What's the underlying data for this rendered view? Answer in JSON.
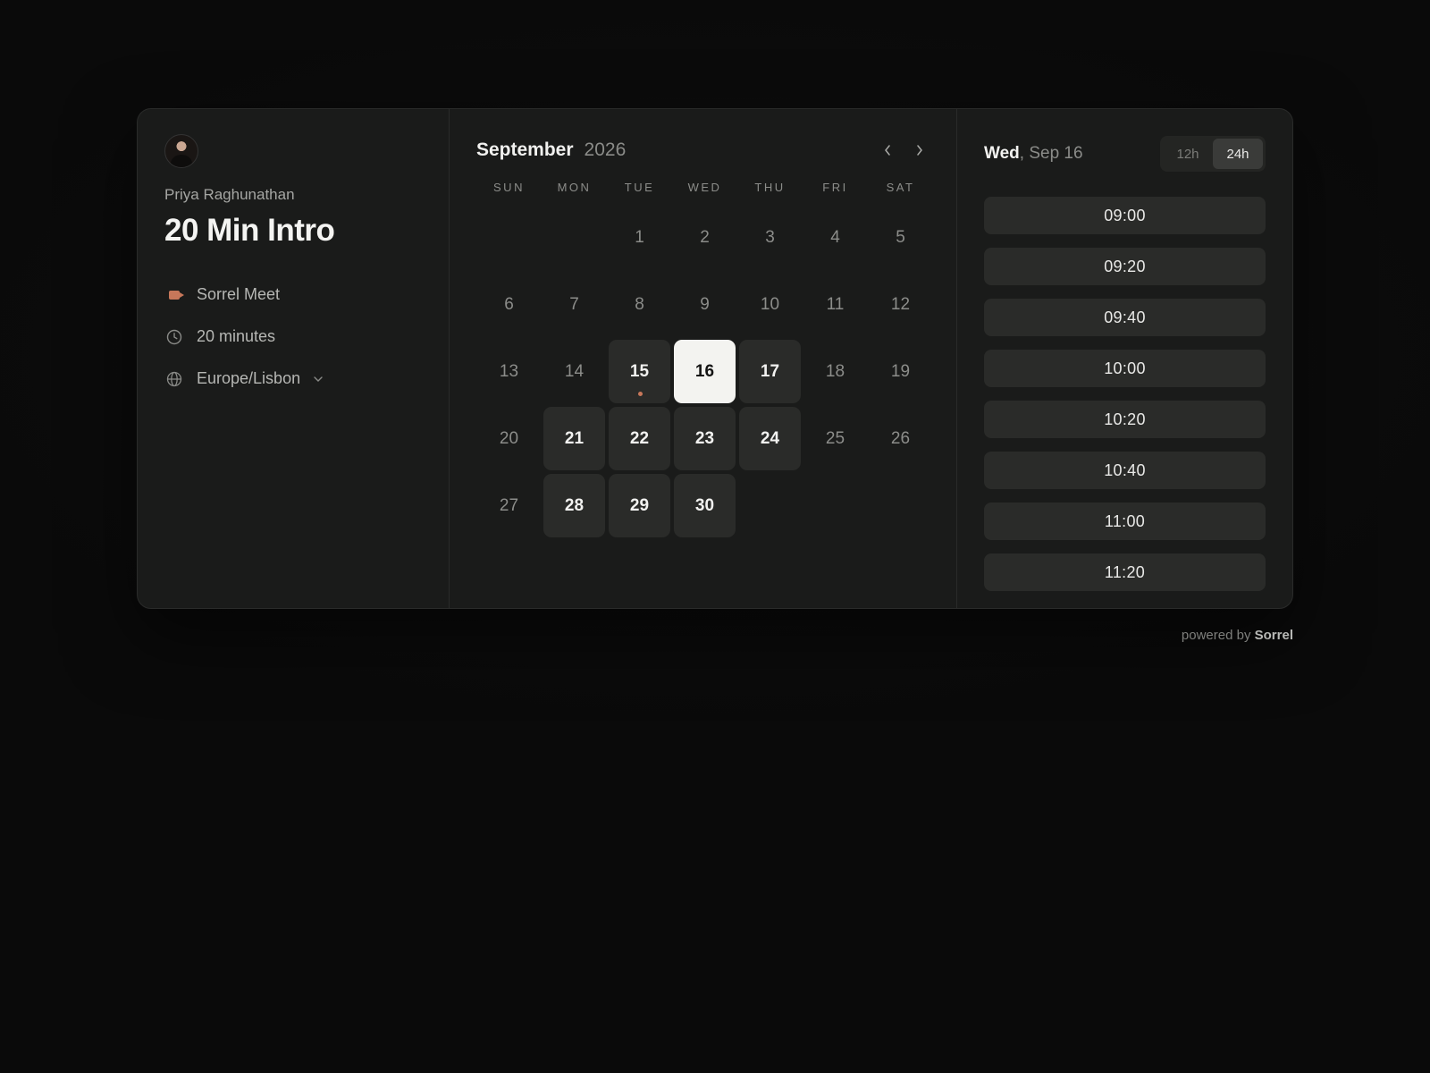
{
  "event": {
    "host": "Priya Raghunathan",
    "title": "20 Min Intro",
    "location": "Sorrel Meet",
    "duration": "20 minutes",
    "timezone": "Europe/Lisbon"
  },
  "calendar": {
    "month": "September",
    "year": "2026",
    "weekdays": [
      "SUN",
      "MON",
      "TUE",
      "WED",
      "THU",
      "FRI",
      "SAT"
    ],
    "leading_blanks": 2,
    "days": [
      {
        "n": "1",
        "state": "off"
      },
      {
        "n": "2",
        "state": "off"
      },
      {
        "n": "3",
        "state": "off"
      },
      {
        "n": "4",
        "state": "off"
      },
      {
        "n": "5",
        "state": "off"
      },
      {
        "n": "6",
        "state": "off"
      },
      {
        "n": "7",
        "state": "off"
      },
      {
        "n": "8",
        "state": "off"
      },
      {
        "n": "9",
        "state": "off"
      },
      {
        "n": "10",
        "state": "off"
      },
      {
        "n": "11",
        "state": "off"
      },
      {
        "n": "12",
        "state": "off"
      },
      {
        "n": "13",
        "state": "off"
      },
      {
        "n": "14",
        "state": "off"
      },
      {
        "n": "15",
        "state": "avail",
        "today": true
      },
      {
        "n": "16",
        "state": "sel"
      },
      {
        "n": "17",
        "state": "avail"
      },
      {
        "n": "18",
        "state": "off"
      },
      {
        "n": "19",
        "state": "off"
      },
      {
        "n": "20",
        "state": "off"
      },
      {
        "n": "21",
        "state": "avail"
      },
      {
        "n": "22",
        "state": "avail"
      },
      {
        "n": "23",
        "state": "avail"
      },
      {
        "n": "24",
        "state": "avail"
      },
      {
        "n": "25",
        "state": "off"
      },
      {
        "n": "26",
        "state": "off"
      },
      {
        "n": "27",
        "state": "off"
      },
      {
        "n": "28",
        "state": "avail"
      },
      {
        "n": "29",
        "state": "avail"
      },
      {
        "n": "30",
        "state": "avail"
      }
    ]
  },
  "slots_panel": {
    "day_name": "Wed",
    "day_date": ", Sep 16",
    "format_12h": "12h",
    "format_24h": "24h",
    "active_format": "24h",
    "times": [
      "09:00",
      "09:20",
      "09:40",
      "10:00",
      "10:20",
      "10:40",
      "11:00",
      "11:20"
    ]
  },
  "footer": {
    "prefix": "powered by",
    "brand": "Sorrel"
  },
  "colors": {
    "accent": "#c7775a",
    "selected_bg": "#f3f3f0",
    "card_bg": "#1a1b1a"
  }
}
